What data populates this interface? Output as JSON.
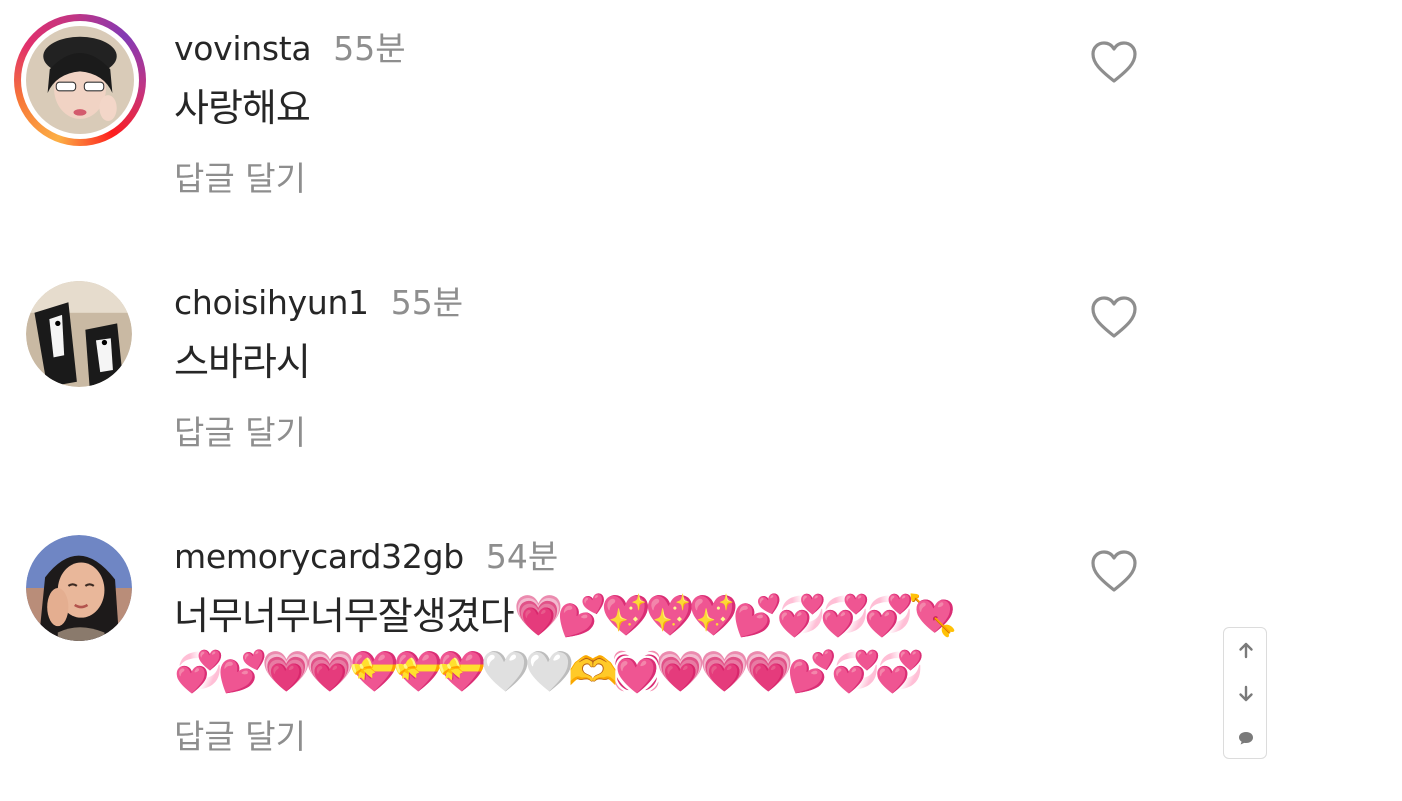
{
  "comments": [
    {
      "username": "vovinsta",
      "time": "55분",
      "text": "사랑해요",
      "reply_label": "답글 달기",
      "avatar": "woman-with-sunglasses-avatar"
    },
    {
      "username": "choisihyun1",
      "time": "55분",
      "text": "스바라시",
      "reply_label": "답글 달기",
      "avatar": "dogs-avatar"
    },
    {
      "username": "memorycard32gb",
      "time": "54분",
      "text": "너무너무너무잘생겼다",
      "emojis_line1": "💗💕💖💖💖💕💞💞💞💘",
      "emojis_line2": "💞💕💗💗💝💝💝",
      "emojis_white": "🤍🤍",
      "emojis_line2b": "🫶💓💗💗💗💕💞💞",
      "reply_label": "답글 달기",
      "avatar": "cartoon-woman-avatar"
    }
  ],
  "icons": {
    "like": "heart-outline-icon",
    "scroll_up": "arrow-up-icon",
    "scroll_down": "arrow-down-icon",
    "comment": "speech-bubble-icon"
  },
  "colors": {
    "text": "#262626",
    "secondary": "#8e8e8e",
    "story_ring": "#e1306c",
    "emoji_pink": "#ff3f95"
  }
}
